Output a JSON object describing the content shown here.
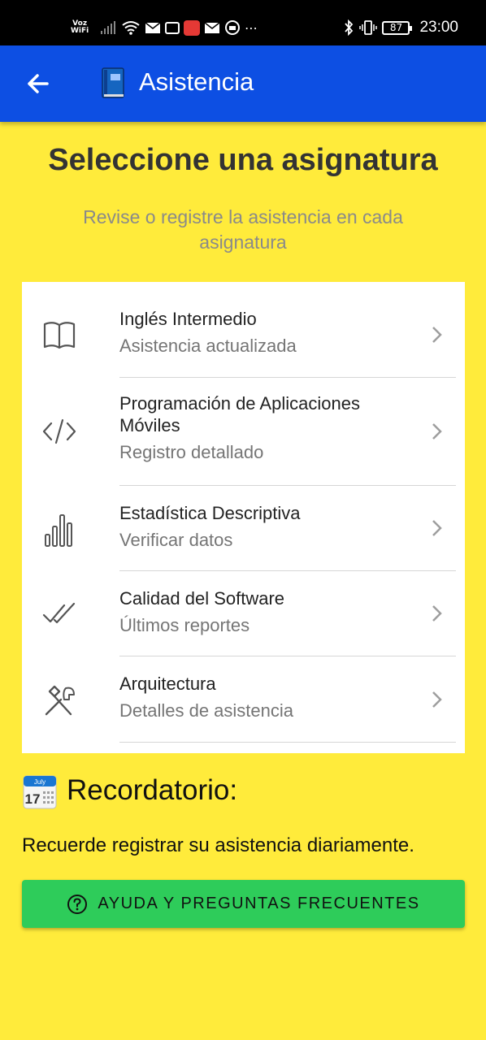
{
  "status_bar": {
    "network_label_line1": "Voz",
    "network_label_line2": "WiFi",
    "battery": "87",
    "time": "23:00"
  },
  "app_bar": {
    "title": "Asistencia",
    "title_icon": "blue-book-icon",
    "back_icon": "arrow-left-icon"
  },
  "header": {
    "title": "Seleccione una asignatura",
    "subtitle": "Revise o registre la asistencia en cada asignatura"
  },
  "courses": [
    {
      "name": "Inglés Intermedio",
      "subtitle": "Asistencia actualizada",
      "icon": "open-book-icon"
    },
    {
      "name": "Programación de Aplicaciones Móviles",
      "subtitle": "Registro detallado",
      "icon": "code-icon"
    },
    {
      "name": "Estadística Descriptiva",
      "subtitle": "Verificar datos",
      "icon": "bar-chart-icon"
    },
    {
      "name": "Calidad del Software",
      "subtitle": "Últimos reportes",
      "icon": "double-check-icon"
    },
    {
      "name": "Arquitectura",
      "subtitle": "Detalles de asistencia",
      "icon": "tools-icon"
    }
  ],
  "reminder": {
    "icon_month": "July",
    "icon_day": "17",
    "title": "Recordatorio:",
    "text": "Recuerde registrar su asistencia diariamente."
  },
  "help_button": {
    "label": "AYUDA Y PREGUNTAS FRECUENTES",
    "icon": "help-circle-icon"
  },
  "colors": {
    "background": "#FFEB3B",
    "app_bar": "#0D4FE3",
    "help_button": "#2ECC5A"
  }
}
